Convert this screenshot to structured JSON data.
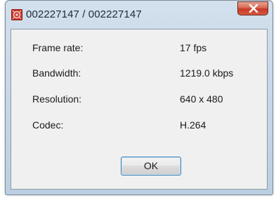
{
  "window": {
    "title": "002227147 / 002227147"
  },
  "stats": [
    {
      "label": "Frame rate:",
      "value": "17 fps"
    },
    {
      "label": "Bandwidth:",
      "value": "1219.0 kbps"
    },
    {
      "label": "Resolution:",
      "value": "640 x 480"
    },
    {
      "label": "Codec:",
      "value": "H.264"
    }
  ],
  "buttons": {
    "ok_label": "OK"
  },
  "colors": {
    "app_icon": "#c8342c",
    "close_button": "#c6382a",
    "ok_border": "#3c7fb1"
  },
  "icons": {
    "app": "camera-app-icon",
    "close": "close-icon"
  }
}
